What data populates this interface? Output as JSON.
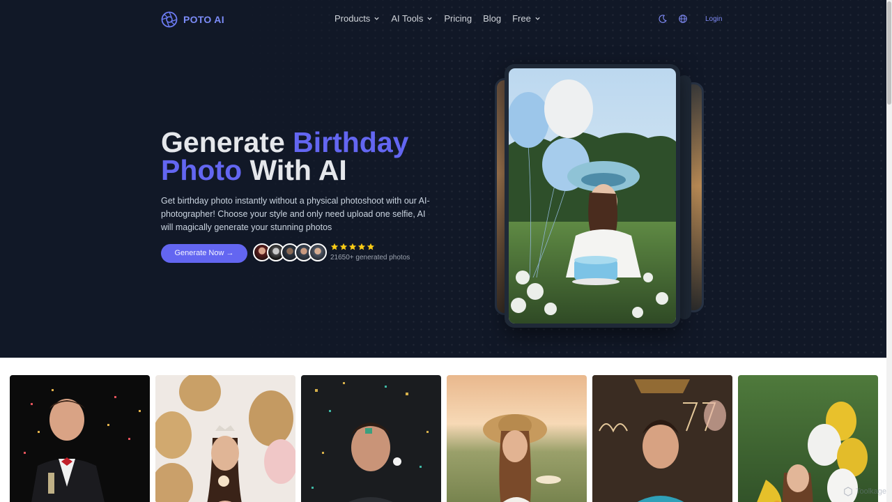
{
  "brand": {
    "name": "POTO AI"
  },
  "nav": {
    "items": [
      {
        "label": "Products",
        "dropdown": true
      },
      {
        "label": "AI Tools",
        "dropdown": true
      },
      {
        "label": "Pricing",
        "dropdown": false
      },
      {
        "label": "Blog",
        "dropdown": false
      },
      {
        "label": "Free",
        "dropdown": true
      }
    ],
    "theme_icon": "moon-icon",
    "language_icon": "globe-icon",
    "login_label": "Login"
  },
  "hero": {
    "title_part1": "Generate ",
    "title_accent1": "Birthday",
    "title_accent2": "Photo",
    "title_part2": " With AI",
    "description": "Get birthday photo instantly without a physical photoshoot with our AI-photographer! Choose your style and only need upload one selfie, AI will magically generate your stunning photos",
    "cta_label": "Generate Now →",
    "rating_stars": 5,
    "generated_count": "21650+ generated photos"
  },
  "colors": {
    "hero_bg": "#111827",
    "accent": "#6366f1",
    "star": "#facc15"
  },
  "gallery": {
    "items": [
      {
        "name": "man-tuxedo-confetti"
      },
      {
        "name": "woman-gold-balloons-cupcake"
      },
      {
        "name": "man-confetti-dark"
      },
      {
        "name": "woman-sunhat-cake-field"
      },
      {
        "name": "man-neon-sign"
      },
      {
        "name": "woman-balloons-garden"
      }
    ]
  },
  "watermark": {
    "text": "Toolkage"
  }
}
